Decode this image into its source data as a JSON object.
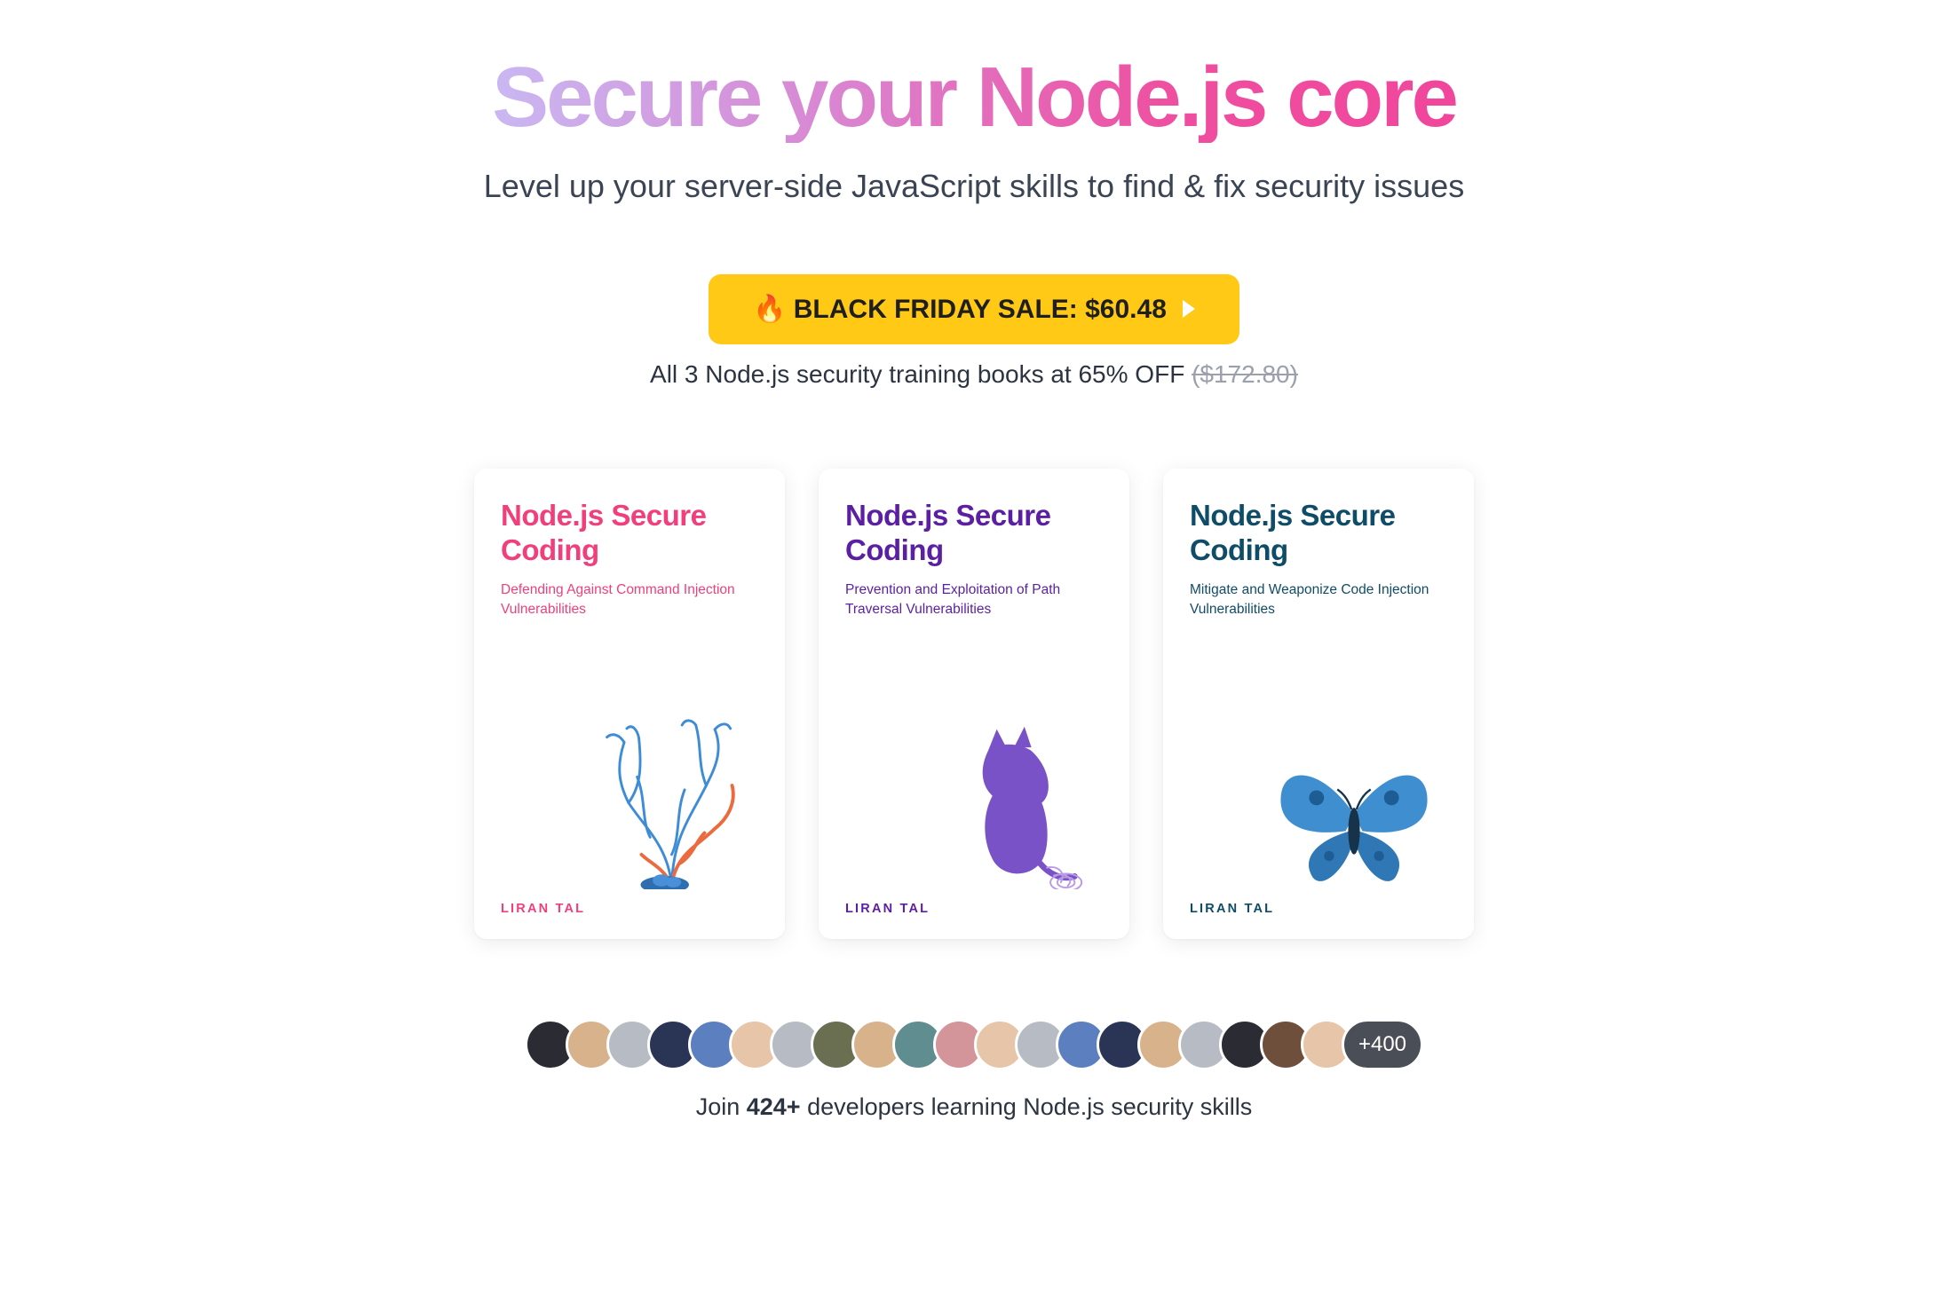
{
  "hero": {
    "headline": "Secure your Node.js core",
    "subhead": "Level up your server-side JavaScript skills to find & fix security issues"
  },
  "cta": {
    "button_label": "🔥 BLACK FRIDAY SALE: $60.48",
    "price_line_prefix": "All 3 Node.js security training books at 65% OFF ",
    "price_strike": "($172.80)"
  },
  "books": [
    {
      "title": "Node.js Secure Coding",
      "subtitle": "Defending Against Command Injection Vulnerabilities",
      "author": "LIRAN TAL",
      "accent": "#f03f7a",
      "art": "coral"
    },
    {
      "title": "Node.js Secure Coding",
      "subtitle": "Prevention and Exploitation of Path Traversal Vulnerabilities",
      "author": "LIRAN TAL",
      "accent": "#5b1fa3",
      "art": "cat"
    },
    {
      "title": "Node.js Secure Coding",
      "subtitle": "Mitigate and Weaponize Code Injection Vulnerabilities",
      "author": "LIRAN TAL",
      "accent": "#0f4c68",
      "art": "butterfly"
    }
  ],
  "social": {
    "avatar_count": 20,
    "more_label": "+400",
    "line_prefix": "Join ",
    "line_count": "424+",
    "line_suffix": " developers learning Node.js security skills"
  }
}
